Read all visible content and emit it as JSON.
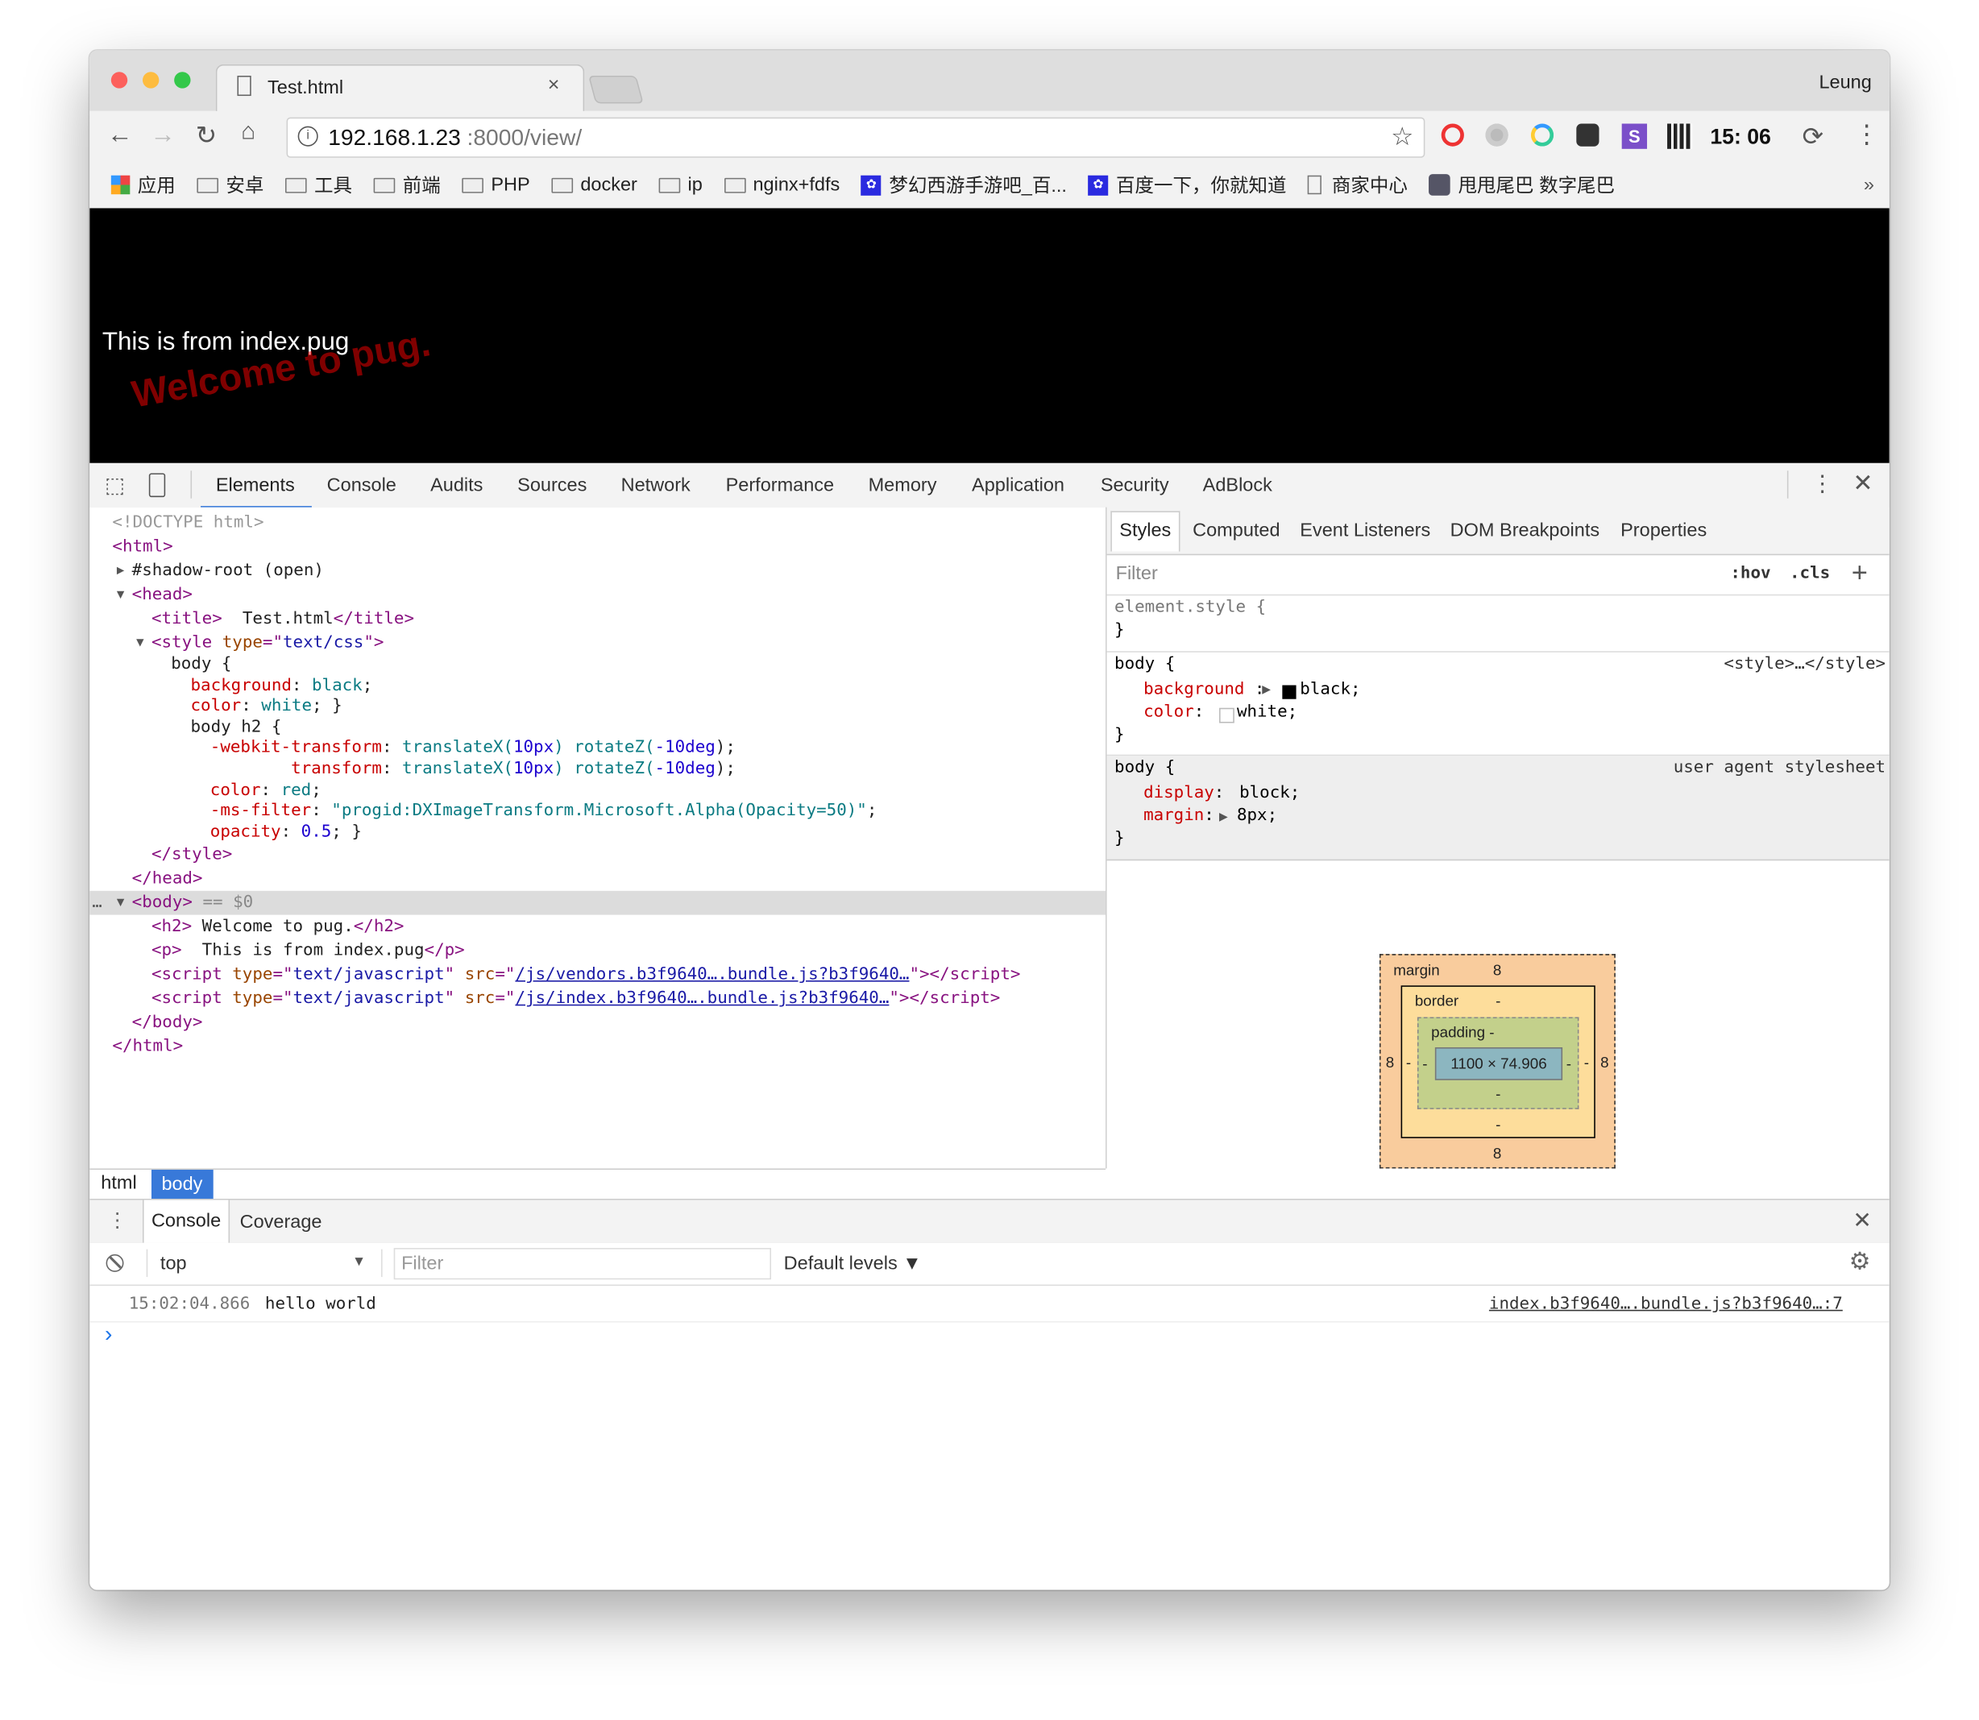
{
  "browser": {
    "tab_title": "Test.html",
    "tab_close": "×",
    "profile": "Leung",
    "url_host": "192.168.1.23",
    "url_rest": ":8000/view/",
    "clock": "15: 06",
    "bookmarks": [
      {
        "label": "应用",
        "icon": "apps-icon"
      },
      {
        "label": "安卓",
        "icon": "folder-icon"
      },
      {
        "label": "工具",
        "icon": "folder-icon"
      },
      {
        "label": "前端",
        "icon": "folder-icon"
      },
      {
        "label": "PHP",
        "icon": "folder-icon"
      },
      {
        "label": "docker",
        "icon": "folder-icon"
      },
      {
        "label": "ip",
        "icon": "folder-icon"
      },
      {
        "label": "nginx+fdfs",
        "icon": "folder-icon"
      },
      {
        "label": "梦幻西游手游吧_百...",
        "icon": "baidu-paw-icon"
      },
      {
        "label": "百度一下，你就知道",
        "icon": "baidu-paw-icon"
      },
      {
        "label": "商家中心",
        "icon": "page-icon"
      },
      {
        "label": "甩甩尾巴 数字尾巴",
        "icon": "site-icon"
      }
    ],
    "bookmarks_more": "»"
  },
  "page": {
    "h2": "Welcome to pug.",
    "p": "This is from index.pug"
  },
  "devtools": {
    "tabs": [
      "Elements",
      "Console",
      "Audits",
      "Sources",
      "Network",
      "Performance",
      "Memory",
      "Application",
      "Security",
      "AdBlock"
    ],
    "active_tab": "Elements",
    "dom_lines": [
      {
        "depth": 0,
        "tk": [
          [
            "<!DOCTYPE html>",
            "dt"
          ]
        ]
      },
      {
        "depth": 0,
        "tk": [
          [
            "<",
            "tg"
          ],
          [
            "html",
            "tn"
          ],
          [
            ">",
            "tg"
          ]
        ]
      },
      {
        "depth": 1,
        "tri": "▶",
        "tk": [
          [
            "#shadow-root (open)",
            "tx"
          ]
        ]
      },
      {
        "depth": 1,
        "tri": "▼",
        "tk": [
          [
            "<",
            "tg"
          ],
          [
            "head",
            "tn"
          ],
          [
            ">",
            "tg"
          ]
        ]
      },
      {
        "depth": 2,
        "tk": [
          [
            "<title>",
            "tg"
          ],
          [
            "  Test.html",
            "tx"
          ],
          [
            "</title>",
            "tg"
          ]
        ]
      },
      {
        "depth": 2,
        "tri": "▼",
        "tk": [
          [
            "<style ",
            "tg"
          ],
          [
            "type",
            "an"
          ],
          [
            "=\"",
            "tg"
          ],
          [
            "text/css",
            "av"
          ],
          [
            "\">",
            "tg"
          ]
        ]
      },
      {
        "depth": 3,
        "css": true,
        "tk": [
          [
            "body {",
            "tx"
          ]
        ]
      },
      {
        "depth": 4,
        "css": true,
        "tk": [
          [
            "background",
            "pr"
          ],
          [
            ": ",
            "tx"
          ],
          [
            "black",
            "pv"
          ],
          [
            ";",
            "tx"
          ]
        ]
      },
      {
        "depth": 4,
        "css": true,
        "tk": [
          [
            "color",
            "pr"
          ],
          [
            ": ",
            "tx"
          ],
          [
            "white",
            "pv"
          ],
          [
            "; }",
            "tx"
          ]
        ]
      },
      {
        "depth": 4,
        "css": true,
        "tk": [
          [
            "body h2 {",
            "tx"
          ]
        ]
      },
      {
        "depth": 5,
        "css": true,
        "tk": [
          [
            "-webkit-transform",
            "pr"
          ],
          [
            ": ",
            "tx"
          ],
          [
            "translateX(",
            "pv"
          ],
          [
            "10px",
            "nm"
          ],
          [
            ") rotateZ(",
            "pv"
          ],
          [
            "-10deg",
            "nm"
          ],
          [
            ");",
            "tx"
          ]
        ]
      },
      {
        "depth": 5,
        "css": true,
        "tk": [
          [
            "        transform",
            "pr"
          ],
          [
            ": ",
            "tx"
          ],
          [
            "translateX(",
            "pv"
          ],
          [
            "10px",
            "nm"
          ],
          [
            ") rotateZ(",
            "pv"
          ],
          [
            "-10deg",
            "nm"
          ],
          [
            ");",
            "tx"
          ]
        ]
      },
      {
        "depth": 5,
        "css": true,
        "tk": [
          [
            "color",
            "pr"
          ],
          [
            ": ",
            "tx"
          ],
          [
            "red",
            "pv"
          ],
          [
            ";",
            "tx"
          ]
        ]
      },
      {
        "depth": 5,
        "css": true,
        "tk": [
          [
            "-ms-filter",
            "pr"
          ],
          [
            ": ",
            "tx"
          ],
          [
            "\"progid:DXImageTransform.Microsoft.Alpha(Opacity=50)\"",
            "pv"
          ],
          [
            ";",
            "tx"
          ]
        ]
      },
      {
        "depth": 5,
        "css": true,
        "tk": [
          [
            "opacity",
            "pr"
          ],
          [
            ": ",
            "tx"
          ],
          [
            "0.5",
            "nm"
          ],
          [
            "; }",
            "tx"
          ]
        ]
      },
      {
        "depth": 2,
        "tk": [
          [
            "</style>",
            "tg"
          ]
        ]
      },
      {
        "depth": 1,
        "tk": [
          [
            "</head>",
            "tg"
          ]
        ]
      },
      {
        "depth": 1,
        "tri": "▼",
        "selected": true,
        "tk": [
          [
            "<body>",
            "tg"
          ],
          [
            " == ",
            "gy"
          ],
          [
            "$0",
            "gy"
          ]
        ]
      },
      {
        "depth": 2,
        "tk": [
          [
            "<h2>",
            "tg"
          ],
          [
            " Welcome to pug.",
            "tx"
          ],
          [
            "</h2>",
            "tg"
          ]
        ]
      },
      {
        "depth": 2,
        "tk": [
          [
            "<p>",
            "tg"
          ],
          [
            "  This is from index.pug",
            "tx"
          ],
          [
            "</p>",
            "tg"
          ]
        ]
      },
      {
        "depth": 2,
        "tk": [
          [
            "<script ",
            "tg"
          ],
          [
            "type",
            "an"
          ],
          [
            "=\"",
            "tg"
          ],
          [
            "text/javascript",
            "av"
          ],
          [
            "\" ",
            "tg"
          ],
          [
            "src",
            "an"
          ],
          [
            "=\"",
            "tg"
          ],
          [
            "/js/vendors.b3f9640….bundle.js?b3f9640…",
            "lk"
          ],
          [
            "\"></script>",
            "tg"
          ]
        ]
      },
      {
        "depth": 2,
        "tk": [
          [
            "<script ",
            "tg"
          ],
          [
            "type",
            "an"
          ],
          [
            "=\"",
            "tg"
          ],
          [
            "text/javascript",
            "av"
          ],
          [
            "\" ",
            "tg"
          ],
          [
            "src",
            "an"
          ],
          [
            "=\"",
            "tg"
          ],
          [
            "/js/index.b3f9640….bundle.js?b3f9640…",
            "lk"
          ],
          [
            "\"></script>",
            "tg"
          ]
        ]
      },
      {
        "depth": 1,
        "tk": [
          [
            "</body>",
            "tg"
          ]
        ]
      },
      {
        "depth": 0,
        "tk": [
          [
            "</html>",
            "tg"
          ]
        ]
      }
    ],
    "breadcrumbs": [
      "html",
      "body"
    ],
    "sidebar_tabs": [
      "Styles",
      "Computed",
      "Event Listeners",
      "DOM Breakpoints",
      "Properties"
    ],
    "filter_placeholder": "Filter",
    "hov": ":hov",
    "cls": ".cls",
    "add_rule": "+",
    "element_style_open": "element.style {",
    "close_brace": "}",
    "rule1": {
      "selector": "body {",
      "source": "<style>…</style>",
      "p1": "background",
      "v1": "black;",
      "p2": "color",
      "v2": "white;"
    },
    "rule2": {
      "selector": "body {",
      "source": "user agent stylesheet",
      "p1": "display",
      "v1": "block;",
      "p2": "margin",
      "v2": "8px;"
    },
    "box_model": {
      "margin_label": "margin",
      "margin_top": "8",
      "margin_bottom": "8",
      "margin_left": "8",
      "margin_right": "8",
      "border_label": "border",
      "border_top": "-",
      "border_bottom": "-",
      "border_left": "-",
      "border_right": "-",
      "padding_label": "padding -",
      "padding_bottom": "-",
      "padding_left": "-",
      "padding_right": "-",
      "content": "1100 × 74.906",
      "colors": {
        "margin": "#f9cc9d",
        "border": "#fddd9b",
        "padding": "#c3d08b",
        "content": "#8cb6c0"
      }
    }
  },
  "drawer": {
    "tabs": [
      "Console",
      "Coverage"
    ],
    "context": "top",
    "filter_placeholder": "Filter",
    "levels": "Default levels ▼",
    "log": {
      "time": "15:02:04.866",
      "message": "hello world",
      "source": "index.b3f9640….bundle.js?b3f9640…:7"
    },
    "prompt": "›"
  }
}
